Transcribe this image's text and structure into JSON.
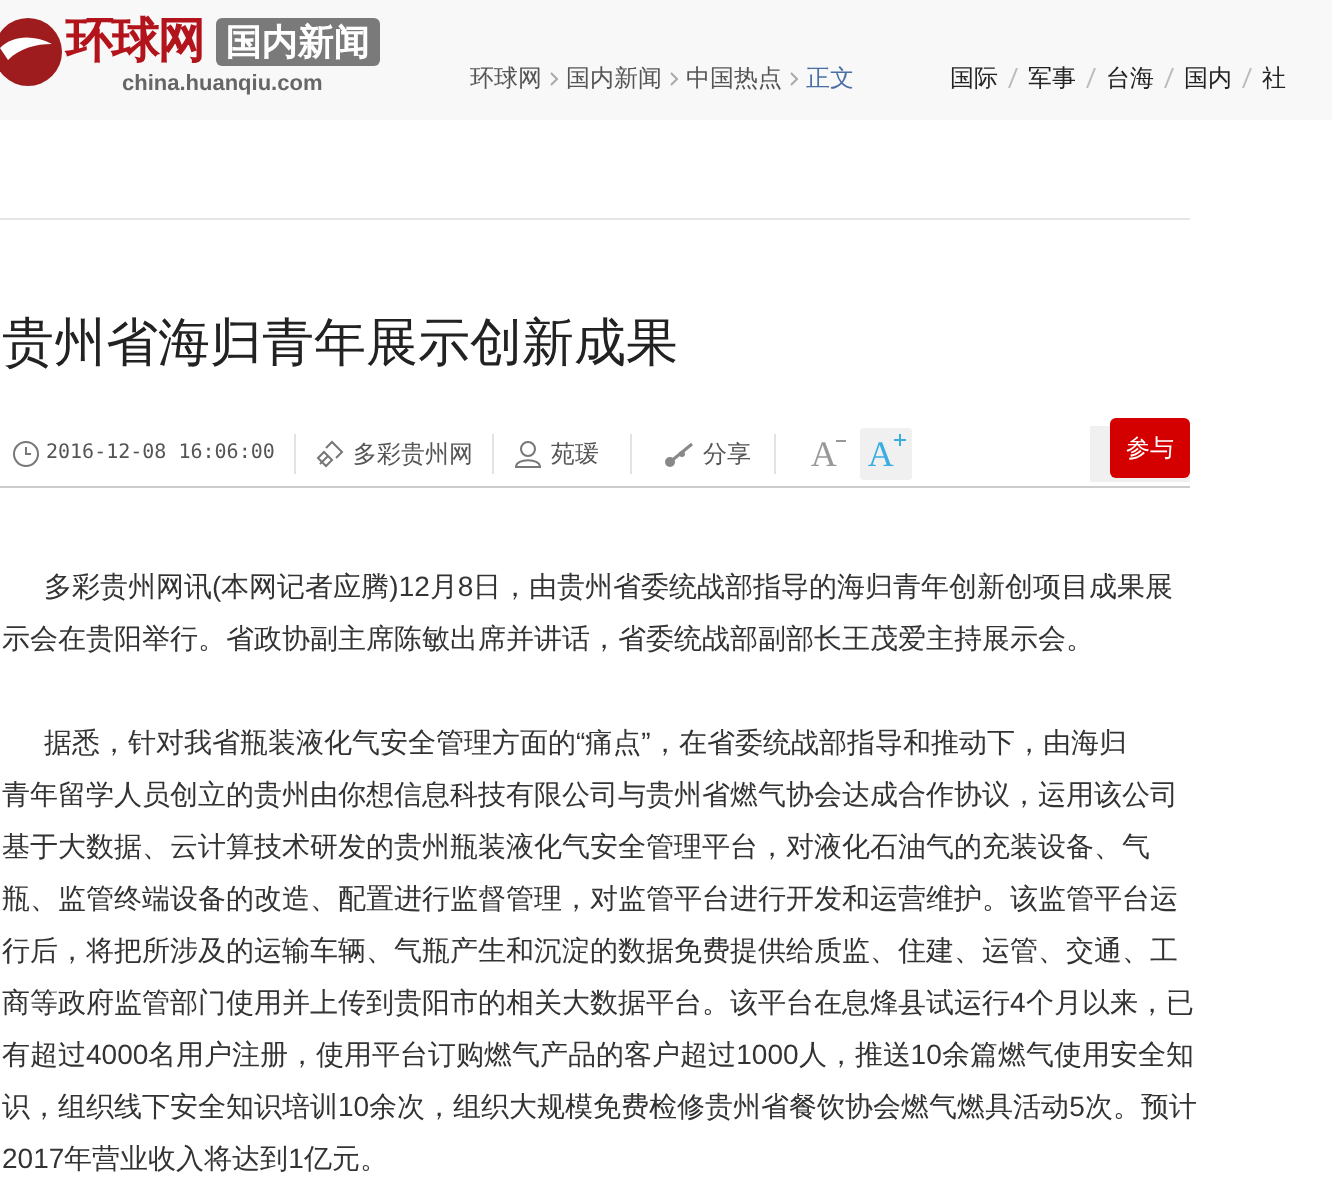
{
  "header": {
    "logo_text": "环球网",
    "section_badge": "国内新闻",
    "domain": "china.huanqiu.com",
    "breadcrumb": [
      {
        "label": "环球网",
        "current": false
      },
      {
        "label": "国内新闻",
        "current": false
      },
      {
        "label": "中国热点",
        "current": false
      },
      {
        "label": "正文",
        "current": true
      }
    ],
    "channels": [
      "国际",
      "军事",
      "台海",
      "国内",
      "社"
    ]
  },
  "article": {
    "title": "贵州省海归青年展示创新成果",
    "meta": {
      "datetime": "2016-12-08 16:06:00",
      "source": "多彩贵州网",
      "author": "苑瑗",
      "share": "分享",
      "font_smaller": "A",
      "font_larger": "A",
      "join_button": "参与"
    },
    "paragraphs": [
      [
        "多彩贵州网讯(本网记者应腾)12月8日，由贵州省委统战部指导的海归青年创新创项目成果展",
        "示会在贵阳举行。省政协副主席陈敏出席并讲话，省委统战部副部长王茂爱主持展示会。"
      ],
      [
        "据悉，针对我省瓶装液化气安全管理方面的“痛点”，在省委统战部指导和推动下，由海归",
        "青年留学人员创立的贵州由你想信息科技有限公司与贵州省燃气协会达成合作协议，运用该公司",
        "基于大数据、云计算技术研发的贵州瓶装液化气安全管理平台，对液化石油气的充装设备、气",
        "瓶、监管终端设备的改造、配置进行监督管理，对监管平台进行开发和运营维护。该监管平台运",
        "行后，将把所涉及的运输车辆、气瓶产生和沉淀的数据免费提供给质监、住建、运管、交通、工",
        "商等政府监管部门使用并上传到贵阳市的相关大数据平台。该平台在息烽县试运行4个月以来，已",
        "有超过4000名用户注册，使用平台订购燃气产品的客户超过1000人，推送10余篇燃气使用安全知",
        "识，组织线下安全知识培训10余次，组织大规模免费检修贵州省餐饮协会燃气燃具活动5次。预计",
        "2017年营业收入将达到1亿元。"
      ]
    ]
  }
}
